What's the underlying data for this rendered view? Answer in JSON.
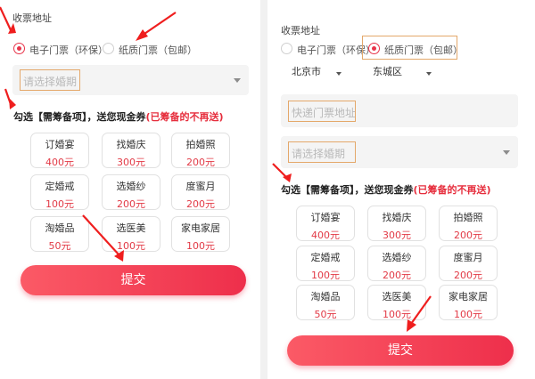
{
  "form_left": {
    "section_title": "收票地址",
    "options": [
      {
        "label": "电子门票（环保）",
        "selected": true
      },
      {
        "label": "纸质门票（包邮）",
        "selected": false
      }
    ],
    "date_placeholder": "请选择婚期",
    "prompt_prefix": "勾选【需筹备项】，送您现金券",
    "prompt_highlight": "(已筹备的不再送)",
    "items": [
      {
        "name": "订婚宴",
        "price": "400元"
      },
      {
        "name": "找婚庆",
        "price": "300元"
      },
      {
        "name": "拍婚照",
        "price": "200元"
      },
      {
        "name": "定婚戒",
        "price": "100元"
      },
      {
        "name": "选婚纱",
        "price": "200元"
      },
      {
        "name": "度蜜月",
        "price": "200元"
      },
      {
        "name": "淘婚品",
        "price": "50元"
      },
      {
        "name": "选医美",
        "price": "100元"
      },
      {
        "name": "家电家居",
        "price": "100元"
      }
    ],
    "submit_label": "提交"
  },
  "form_right": {
    "section_title": "收票地址",
    "options": [
      {
        "label": "电子门票（环保）",
        "selected": false
      },
      {
        "label": "纸质门票（包邮）",
        "selected": true
      }
    ],
    "city": "北京市",
    "district": "东城区",
    "address_placeholder": "快递门票地址",
    "date_placeholder": "请选择婚期",
    "prompt_prefix": "勾选【需筹备项】，送您现金券",
    "prompt_highlight": "(已筹备的不再送)",
    "items": [
      {
        "name": "订婚宴",
        "price": "400元"
      },
      {
        "name": "找婚庆",
        "price": "300元"
      },
      {
        "name": "拍婚照",
        "price": "200元"
      },
      {
        "name": "定婚戒",
        "price": "100元"
      },
      {
        "name": "选婚纱",
        "price": "200元"
      },
      {
        "name": "度蜜月",
        "price": "200元"
      },
      {
        "name": "淘婚品",
        "price": "50元"
      },
      {
        "name": "选医美",
        "price": "100元"
      },
      {
        "name": "家电家居",
        "price": "100元"
      }
    ],
    "submit_label": "提交"
  },
  "colors": {
    "accent": "#e8344a",
    "price": "#e23a46",
    "highlight_border": "#e4a86a",
    "arrow": "#ef1e1e"
  }
}
